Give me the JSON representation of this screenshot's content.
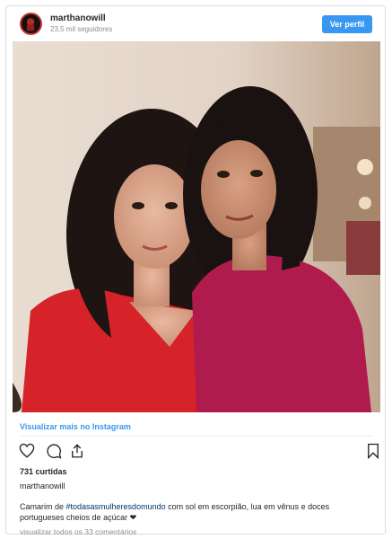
{
  "header": {
    "username": "marthanowill",
    "followers": "23,5 mil seguidores",
    "profile_button": "Ver perfil"
  },
  "post": {
    "image_alt": "Two women posing together in a dressing room",
    "view_more_link": "Visualizar mais no Instagram",
    "likes": "731 curtidas",
    "caption_username": "marthanowill",
    "caption_before": "Camarim de ",
    "caption_hashtag": "#todasasmulheresdomundo",
    "caption_after": " com sol em escorpião, lua em vênus e doces portugueses cheios de açúcar ❤",
    "view_comments": "visualizar todos os 33 comentários"
  },
  "icons": {
    "like": "heart-icon",
    "comment": "comment-icon",
    "share": "share-icon",
    "save": "bookmark-icon"
  },
  "colors": {
    "accent": "#3897f0",
    "text": "#262626",
    "muted": "#8e8e8e",
    "hashtag": "#003569"
  }
}
